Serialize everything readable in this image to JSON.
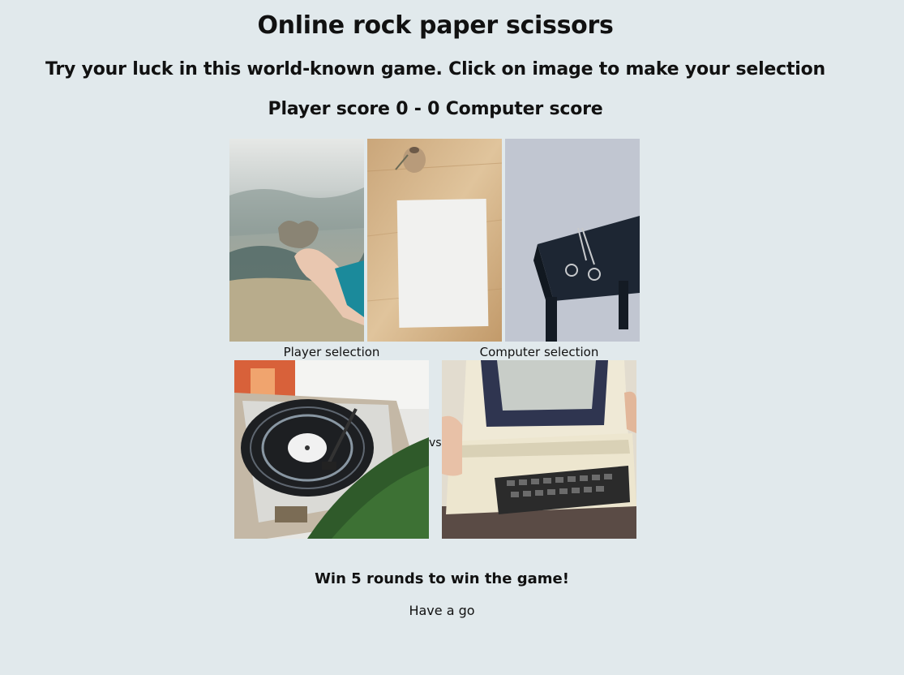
{
  "header": {
    "title": "Online rock paper scissors",
    "subtitle": "Try your luck in this world-known game. Click on image to make your selection",
    "score_line": "Player score 0 - 0 Computer score"
  },
  "score": {
    "player": 0,
    "computer": 0
  },
  "choices": [
    {
      "name": "rock",
      "icon": "heart-shaped-rock-photo"
    },
    {
      "name": "paper",
      "icon": "blank-paper-sheet-photo"
    },
    {
      "name": "scissors",
      "icon": "scissors-on-stool-photo"
    }
  ],
  "selection": {
    "player_label": "Player selection",
    "computer_label": "Computer selection",
    "vs_label": "vs",
    "player_image": "record-player-photo",
    "computer_image": "retro-computer-photo"
  },
  "footer": {
    "rule": "Win 5 rounds to win the game!",
    "status": "Have a go"
  },
  "colors": {
    "background": "#e1e9ec",
    "text": "#111111"
  }
}
